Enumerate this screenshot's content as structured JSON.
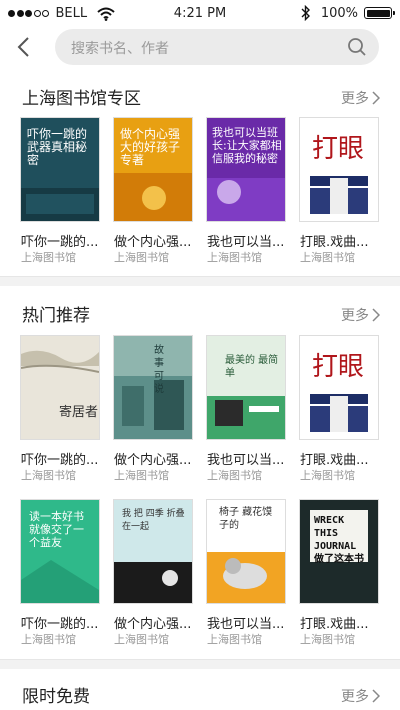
{
  "status": {
    "carrier": "BELL",
    "time": "4:21 PM",
    "battery": "100%",
    "battery_level": 1.0,
    "signal_filled": 3,
    "signal_total": 5
  },
  "search": {
    "placeholder": "搜索书名、作者"
  },
  "sections": [
    {
      "title": "上海图书馆专区",
      "more": "更多",
      "books": [
        {
          "title": "吓你一跳的...",
          "publisher": "上海图书馆",
          "cover_text": "吓你一跳的武器真相秘密",
          "color": "#1f4f5c"
        },
        {
          "title": "做个内心强...",
          "publisher": "上海图书馆",
          "cover_text": "做个内心强大的好孩子专著",
          "color": "#e8a012"
        },
        {
          "title": "我也可以当...",
          "publisher": "上海图书馆",
          "cover_text": "我也可以当班长:让大家都相信服我的秘密",
          "color": "#6a2aa8"
        },
        {
          "title": "打眼.戏曲...",
          "publisher": "上海图书馆",
          "cover_text": "打眼",
          "color": "#ffffff"
        }
      ]
    },
    {
      "title": "热门推荐",
      "more": "更多",
      "books": [
        {
          "title": "吓你一跳的...",
          "publisher": "上海图书馆",
          "cover_text": "寄居者",
          "color": "#e9e5da"
        },
        {
          "title": "做个内心强...",
          "publisher": "上海图书馆",
          "cover_text": "故事可说",
          "color": "#5d8f8a"
        },
        {
          "title": "我也可以当...",
          "publisher": "上海图书馆",
          "cover_text": "最美的 最简单",
          "color": "#e3efe3"
        },
        {
          "title": "打眼.戏曲...",
          "publisher": "上海图书馆",
          "cover_text": "打眼",
          "color": "#ffffff"
        },
        {
          "title": "吓你一跳的...",
          "publisher": "上海图书馆",
          "cover_text": "读一本好书就像交了一个益友",
          "color": "#2fb98a"
        },
        {
          "title": "做个内心强...",
          "publisher": "上海图书馆",
          "cover_text": "我 把 四季 折叠 在一起",
          "color": "#cfe8ea"
        },
        {
          "title": "我也可以当...",
          "publisher": "上海图书馆",
          "cover_text": "椅子 藏花馍子的",
          "color": "#f2a423"
        },
        {
          "title": "打眼.戏曲...",
          "publisher": "上海图书馆",
          "cover_text": "WRECK THIS JOURNAL 做了这本书",
          "color": "#1d2a2a"
        }
      ]
    },
    {
      "title": "限时免费",
      "more": "更多"
    }
  ]
}
